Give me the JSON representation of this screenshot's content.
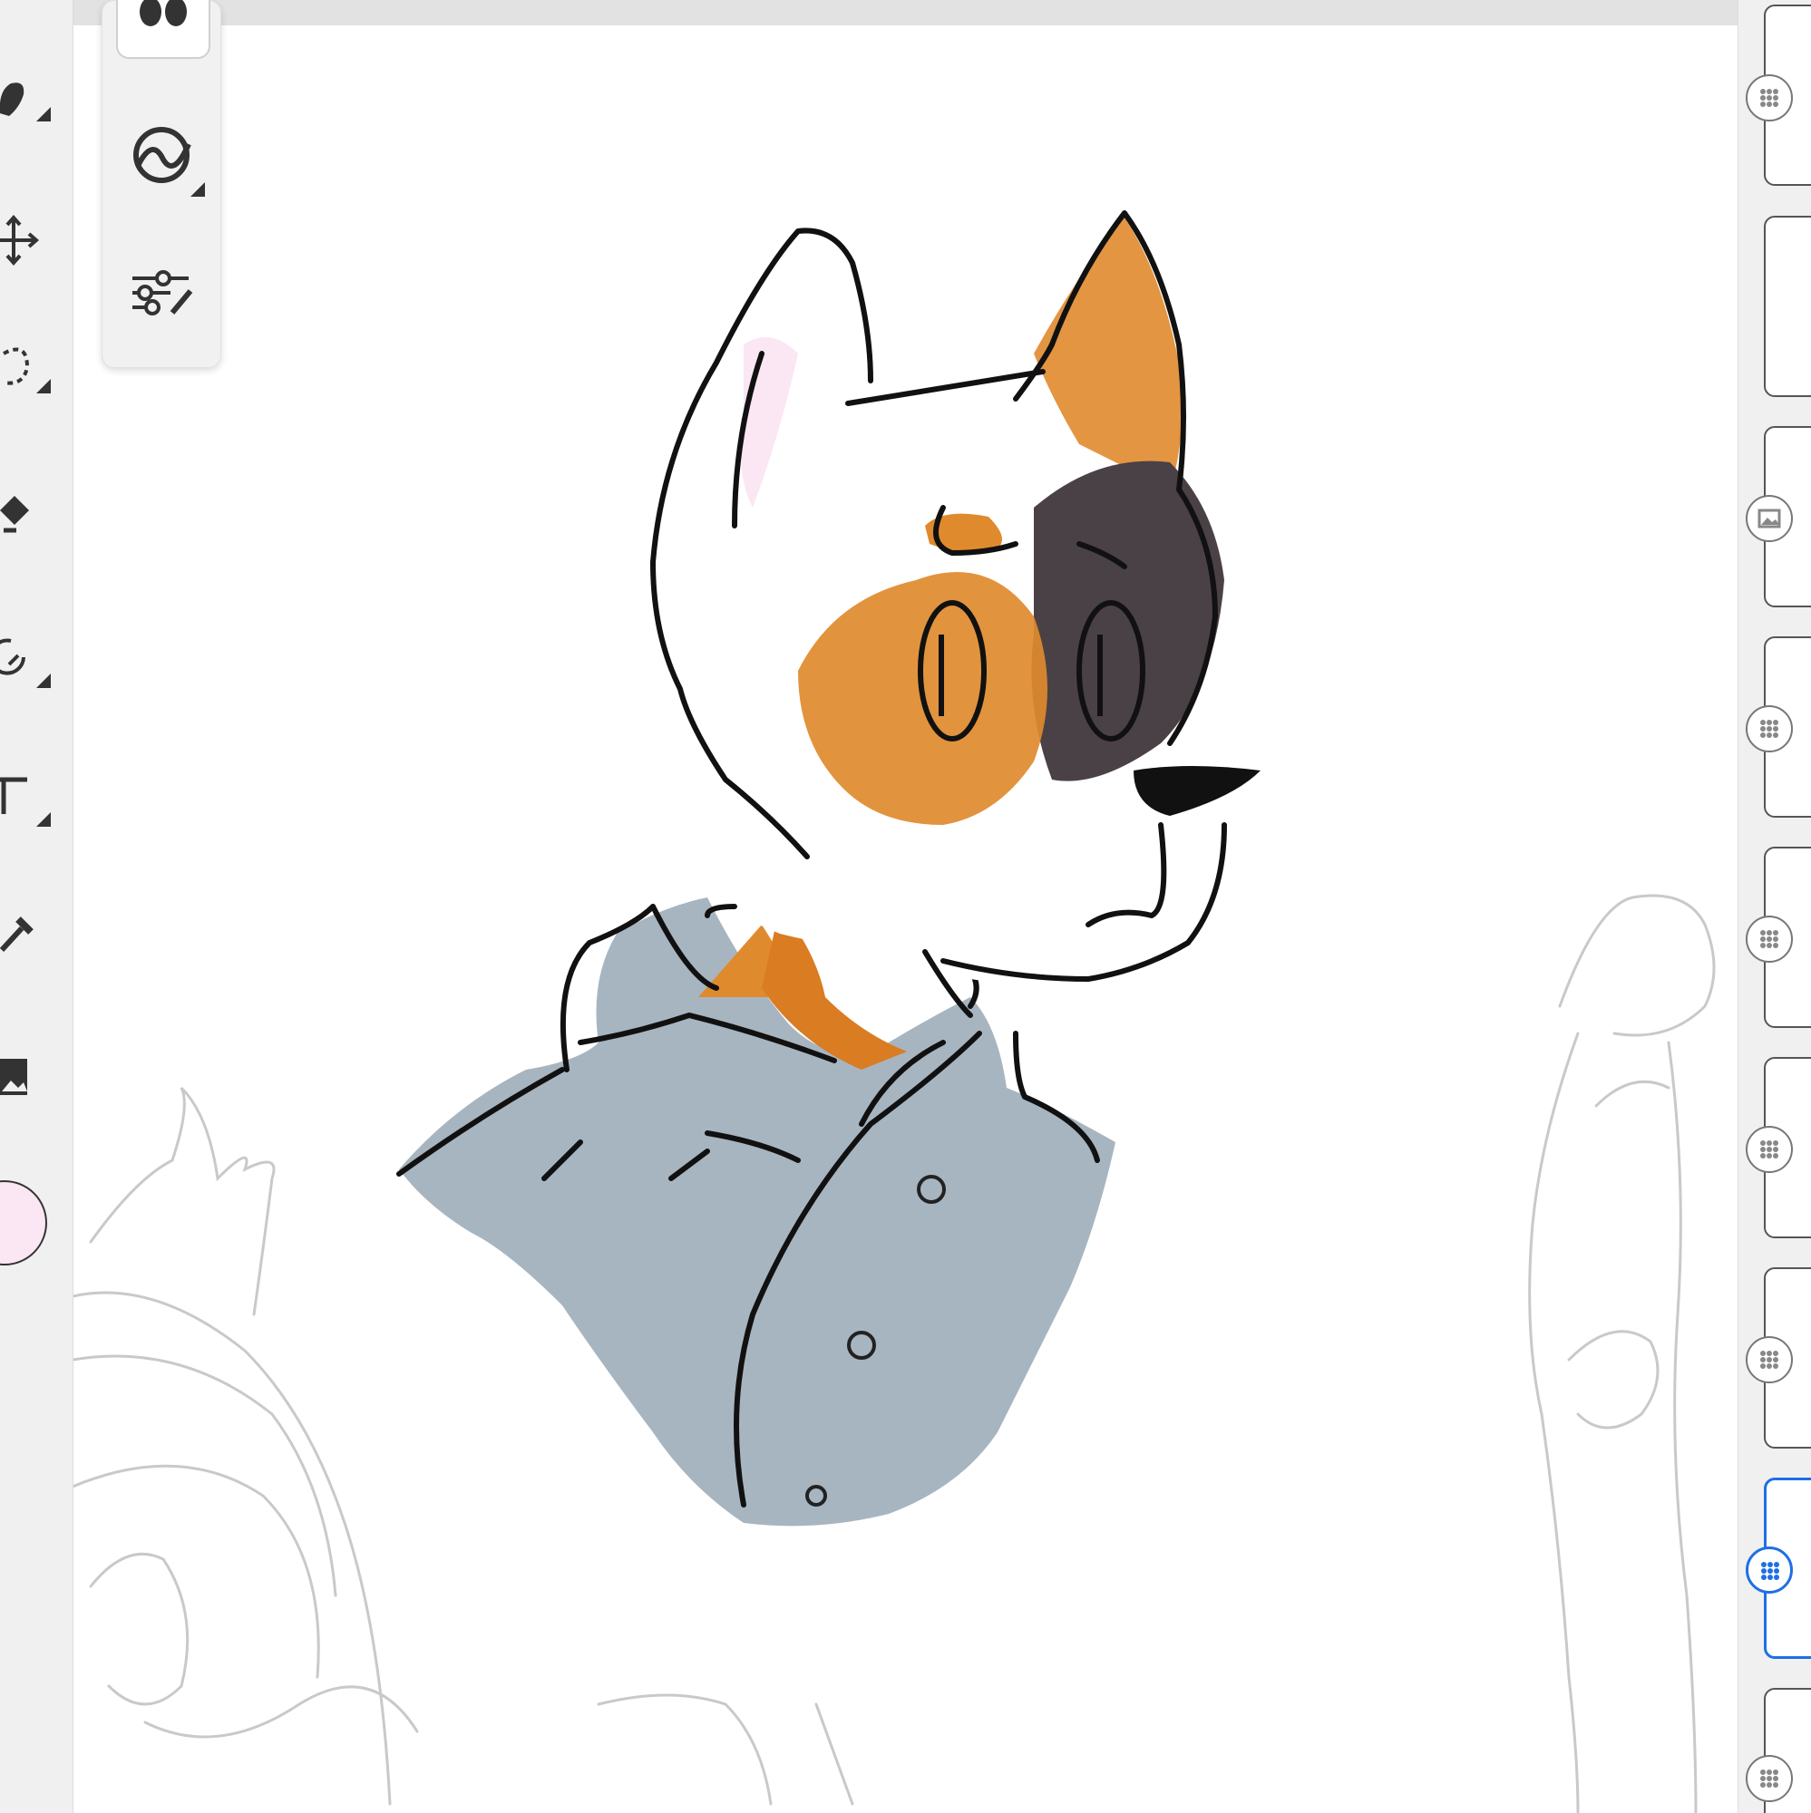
{
  "app": {
    "accent_color": "#1e6fe6",
    "canvas_background": "#ffffff"
  },
  "toolbar": {
    "tools": [
      {
        "name": "brush",
        "icon": "brush-icon"
      },
      {
        "name": "move",
        "icon": "move-icon"
      },
      {
        "name": "selection",
        "icon": "lasso-selection-icon"
      },
      {
        "name": "fill",
        "icon": "paint-bucket-icon"
      },
      {
        "name": "transform",
        "icon": "rotate-icon"
      },
      {
        "name": "text",
        "icon": "text-icon"
      },
      {
        "name": "eyedropper",
        "icon": "eyedropper-icon"
      },
      {
        "name": "image",
        "icon": "image-icon"
      }
    ],
    "current_color": "#fbe6f4"
  },
  "brush_panel": {
    "buttons": [
      {
        "name": "opacity-flow",
        "icon": "droplets-icon"
      },
      {
        "name": "stabilizer",
        "icon": "stabilizer-icon"
      },
      {
        "name": "brush-settings",
        "icon": "sliders-icon"
      }
    ]
  },
  "layers": {
    "items": [
      {
        "type": "pixel",
        "icon": "grid-layer-icon",
        "active": false
      },
      {
        "type": "pixel",
        "icon": "grid-layer-icon",
        "active": false
      },
      {
        "type": "image",
        "icon": "image-layer-icon",
        "active": false
      },
      {
        "type": "pixel",
        "icon": "grid-layer-icon",
        "active": false
      },
      {
        "type": "pixel",
        "icon": "grid-layer-icon",
        "active": false
      },
      {
        "type": "pixel",
        "icon": "grid-layer-icon",
        "active": false
      },
      {
        "type": "pixel",
        "icon": "grid-layer-icon",
        "active": false
      },
      {
        "type": "pixel",
        "icon": "grid-layer-icon",
        "active": true
      },
      {
        "type": "pixel",
        "icon": "grid-layer-icon",
        "active": false
      }
    ]
  }
}
